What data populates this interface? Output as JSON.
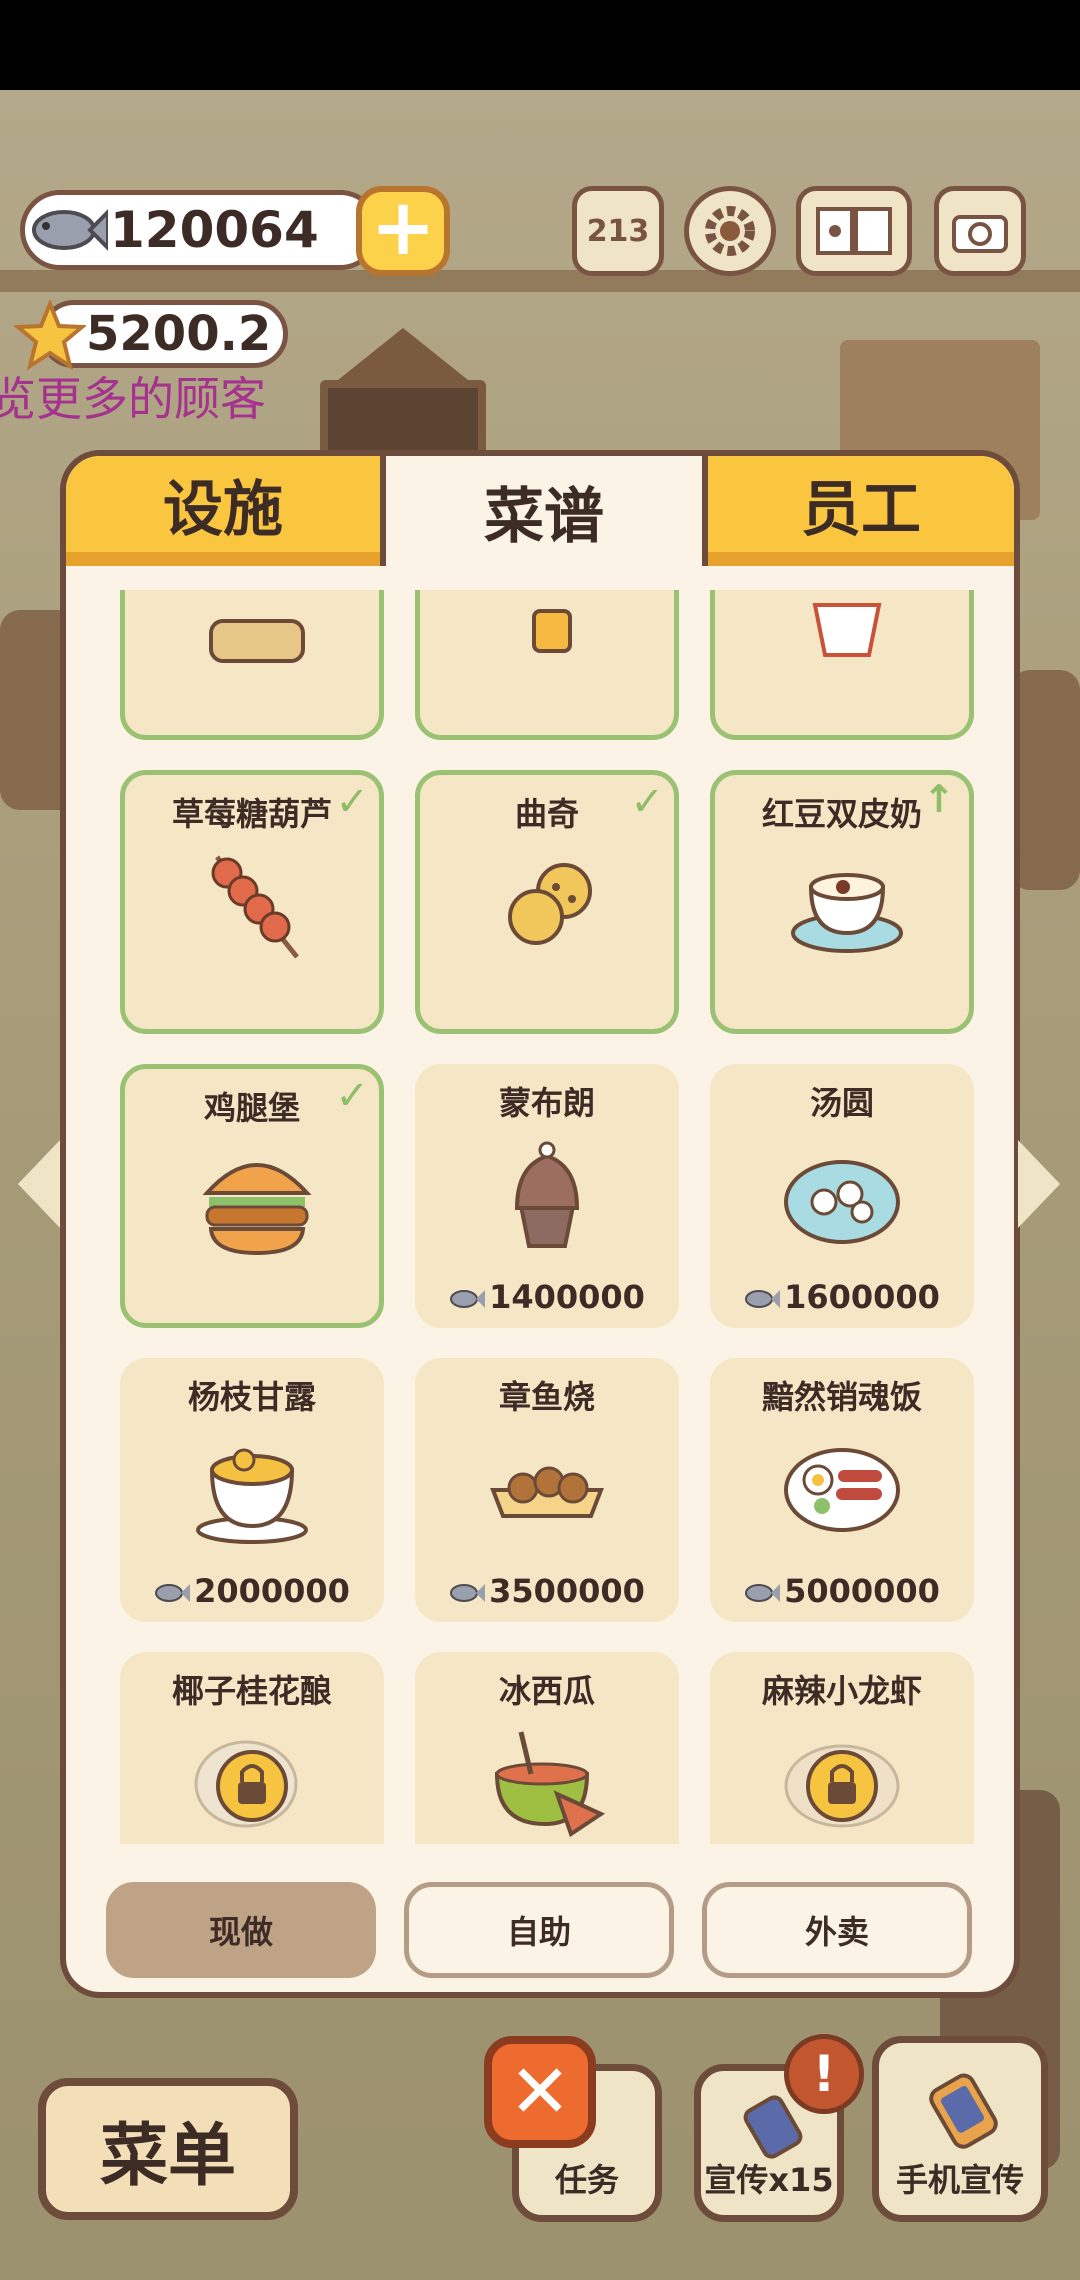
{
  "currency": {
    "fish": "120064",
    "stars": "5200.2",
    "hint": "览更多的顾客"
  },
  "top_icons": {
    "rank": "213"
  },
  "tabs": [
    {
      "label": "设施",
      "active": false
    },
    {
      "label": "菜谱",
      "active": true
    },
    {
      "label": "员工",
      "active": false
    }
  ],
  "recipes": {
    "row0": [
      {
        "name": "",
        "state": "owned"
      },
      {
        "name": "",
        "state": "owned"
      },
      {
        "name": "",
        "state": "owned"
      }
    ],
    "row1": [
      {
        "name": "草莓糖葫芦",
        "state": "owned"
      },
      {
        "name": "曲奇",
        "state": "owned"
      },
      {
        "name": "红豆双皮奶",
        "state": "upgradable"
      }
    ],
    "row2": [
      {
        "name": "鸡腿堡",
        "state": "owned"
      },
      {
        "name": "蒙布朗",
        "price": "1400000"
      },
      {
        "name": "汤圆",
        "price": "1600000"
      }
    ],
    "row3": [
      {
        "name": "杨枝甘露",
        "price": "2000000"
      },
      {
        "name": "章鱼烧",
        "price": "3500000"
      },
      {
        "name": "黯然销魂饭",
        "price": "5000000"
      }
    ],
    "row4": [
      {
        "name": "椰子桂花酿",
        "state": "locked"
      },
      {
        "name": "冰西瓜"
      },
      {
        "name": "麻辣小龙虾",
        "state": "locked"
      }
    ]
  },
  "sub_tabs": [
    {
      "label": "现做",
      "active": true
    },
    {
      "label": "自助",
      "active": false
    },
    {
      "label": "外卖",
      "active": false
    }
  ],
  "bottom": {
    "menu": "菜单",
    "close": "✕",
    "tasks": "任务",
    "promo": "宣传x15",
    "phone_promo": "手机宣传",
    "alert": "!"
  },
  "colors": {
    "accent": "#fbc63f",
    "owned_border": "#9bc173",
    "close": "#ee6b2f",
    "frame": "#6e4c3c"
  }
}
